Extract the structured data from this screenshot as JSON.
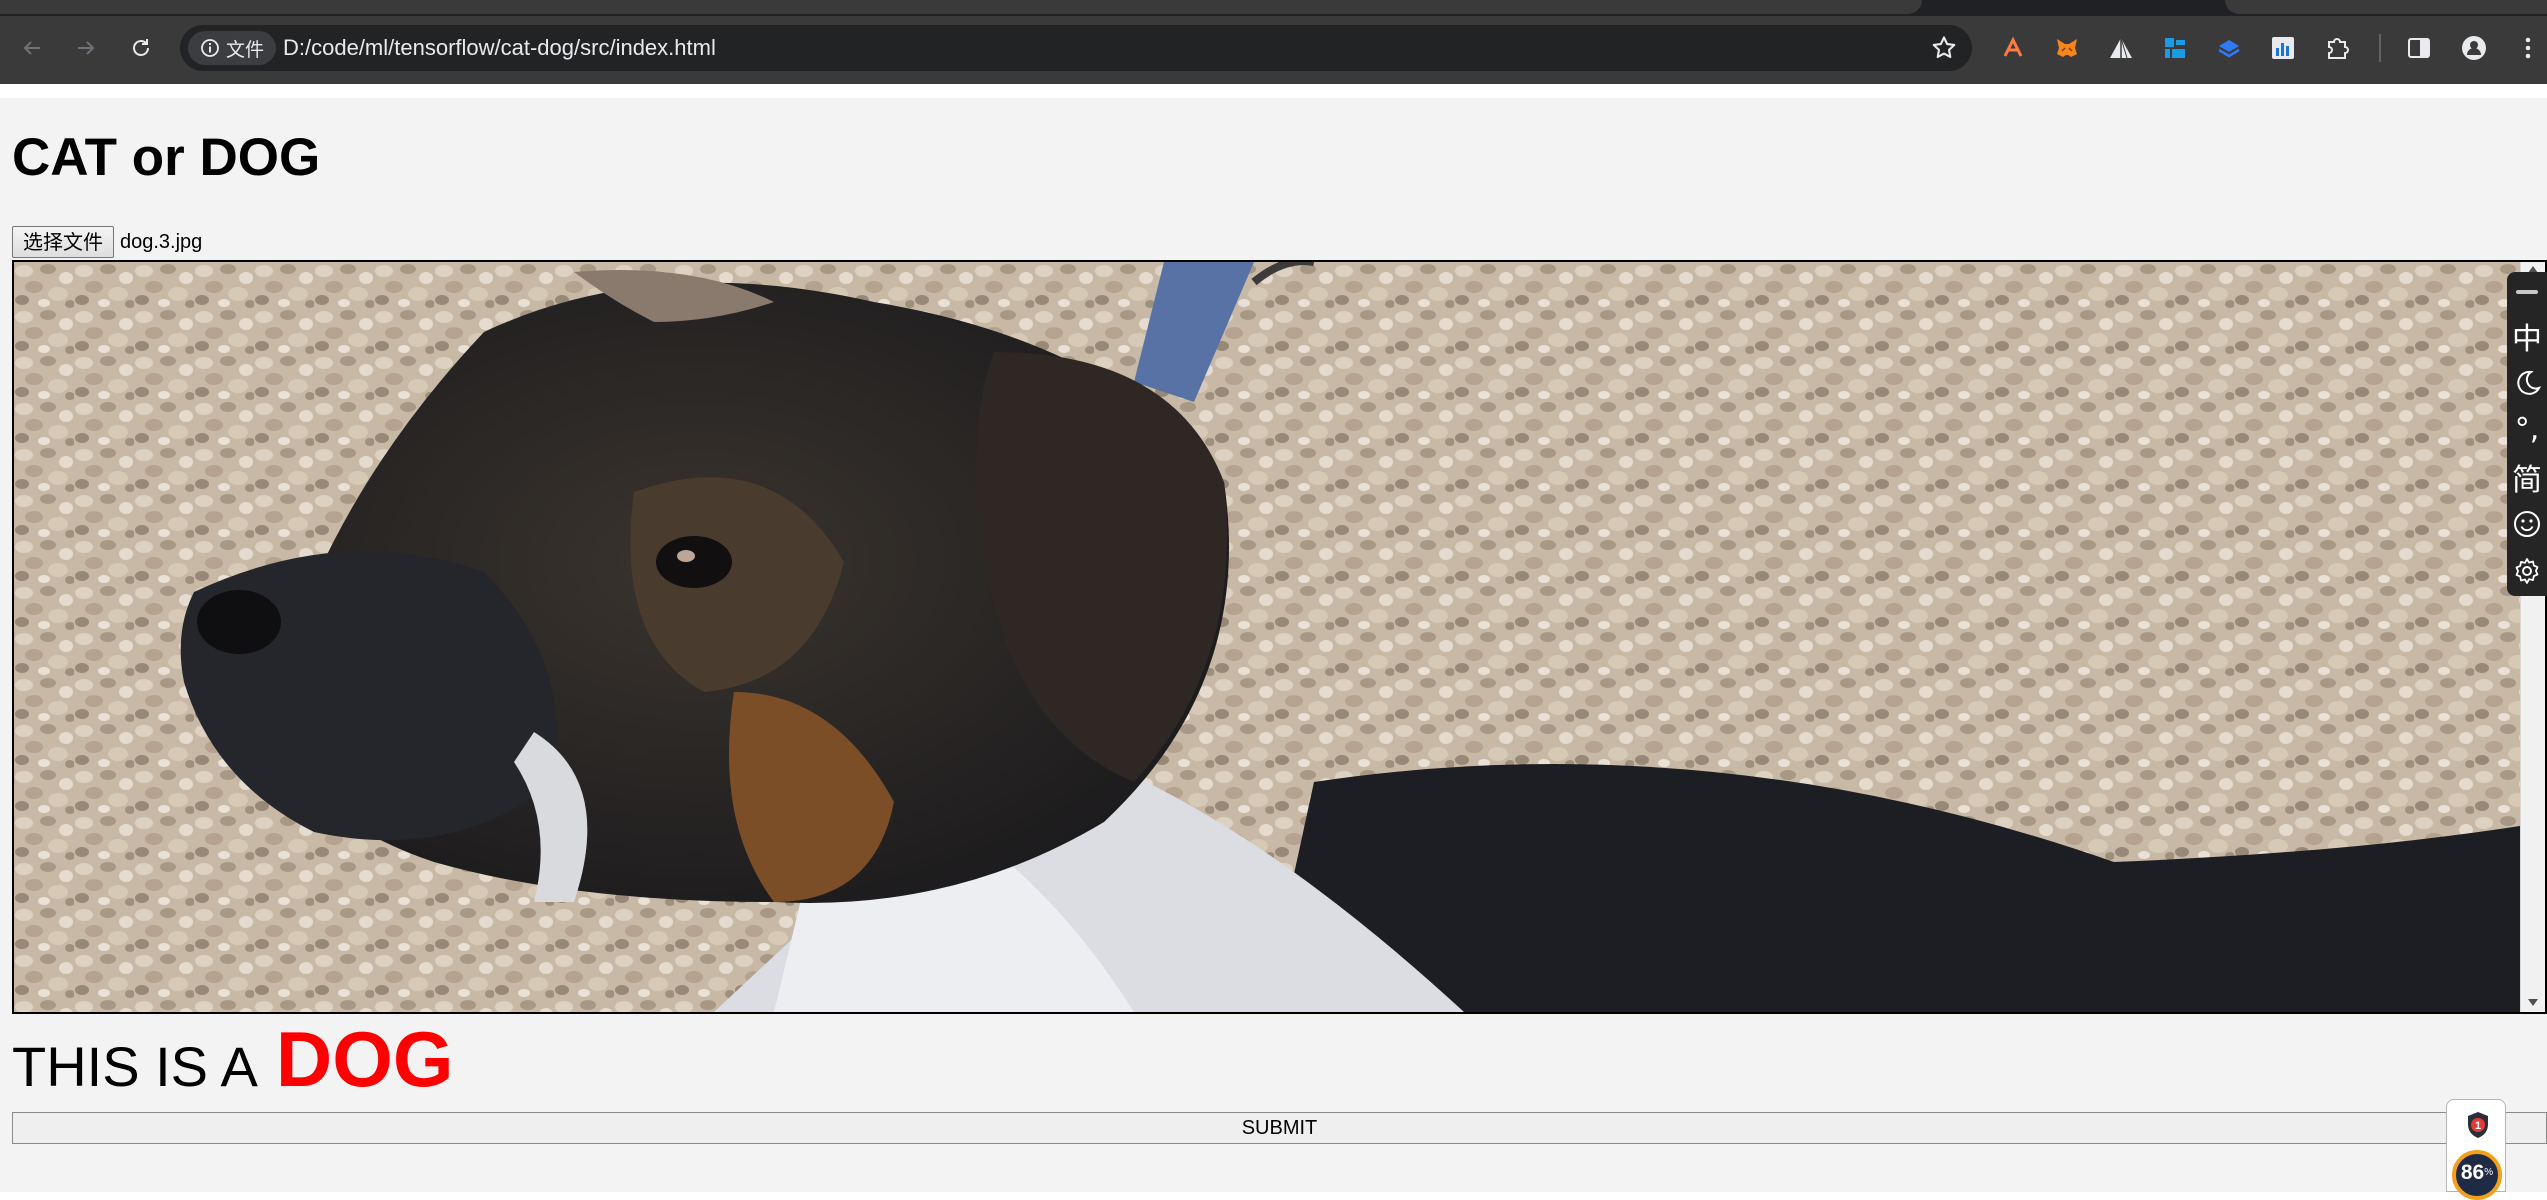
{
  "browser": {
    "site_info_label": "文件",
    "url": "D:/code/ml/tensorflow/cat-dog/src/index.html",
    "extensions": [
      "spark-extension-icon",
      "metamask-fox-icon",
      "triangle-extension-icon",
      "grid-extension-icon",
      "layers-extension-icon",
      "chart-extension-icon",
      "puzzle-extensions-icon"
    ],
    "accent": "#e8eaed"
  },
  "page": {
    "title": "CAT or DOG",
    "file_button_label": "选择文件",
    "file_name": "dog.3.jpg",
    "result_prefix": "THIS IS A",
    "result_class": "DOG",
    "result_color": "#ff0000",
    "submit_label": "SUBMIT"
  },
  "ime_toolbar": {
    "items": [
      "中",
      "moon-icon",
      "°,",
      "简",
      "emoji-icon",
      "gear-icon"
    ]
  },
  "float_widget": {
    "badge_count": "1",
    "percent": "86",
    "percent_sign": "%"
  }
}
